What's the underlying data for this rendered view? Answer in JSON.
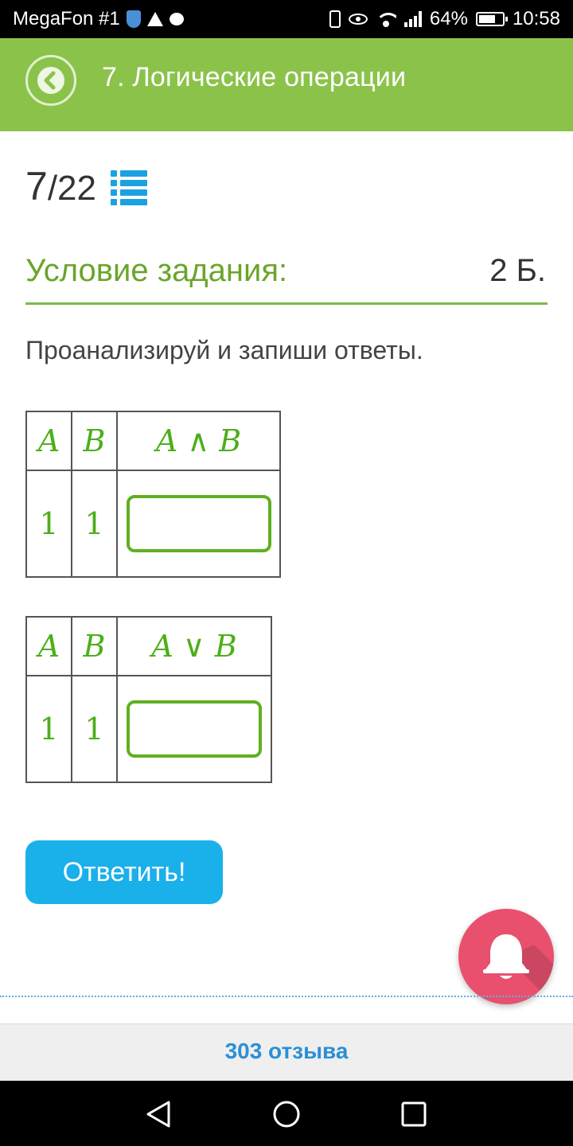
{
  "status_bar": {
    "carrier": "MegaFon #1",
    "battery": "64%",
    "time": "10:58"
  },
  "header": {
    "title": "7. Логические операции",
    "back_icon": "chevron-left-icon"
  },
  "progress": {
    "current": "7",
    "total": "/22",
    "list_icon": "list-icon"
  },
  "condition": {
    "title": "Условие задания:",
    "points": "2 Б."
  },
  "instruction": "Проанализируй и запиши ответы.",
  "tables": [
    {
      "headers": [
        "A",
        "B",
        "A ∧ B"
      ],
      "row": [
        "1",
        "1"
      ],
      "answer": ""
    },
    {
      "headers": [
        "A",
        "B",
        "A ∨ B"
      ],
      "row": [
        "1",
        "1"
      ],
      "answer": ""
    }
  ],
  "submit_label": "Ответить!",
  "reviews_label": "303 отзыва",
  "colors": {
    "header_green": "#8bc34a",
    "accent_green": "#6aa52a",
    "button_blue": "#1ab0ea",
    "bell_pink": "#e8506e",
    "link_blue": "#2b8fd6"
  }
}
